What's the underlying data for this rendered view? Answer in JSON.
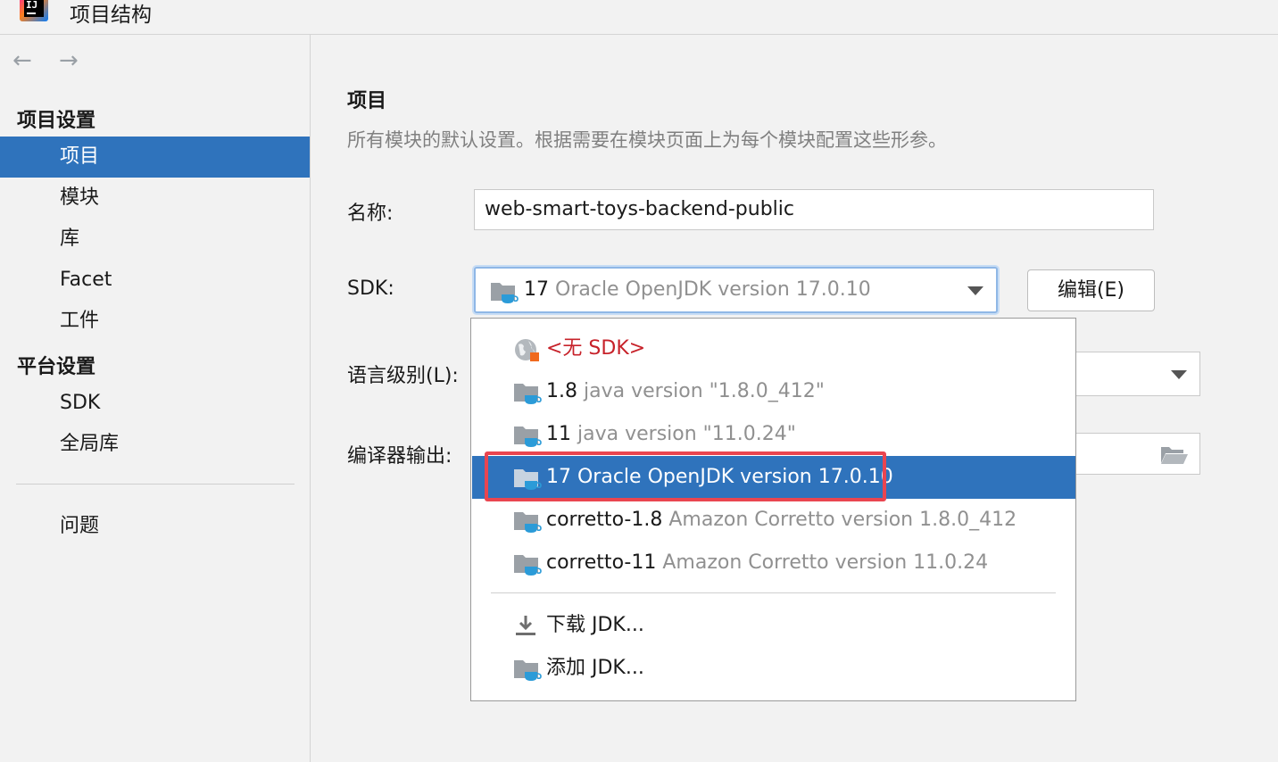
{
  "window": {
    "title": "项目结构"
  },
  "nav": {
    "back": "←",
    "forward": "→"
  },
  "sidebar": {
    "project_settings_header": "项目设置",
    "project_items": [
      "项目",
      "模块",
      "库",
      "Facet",
      "工件"
    ],
    "platform_settings_header": "平台设置",
    "platform_items": [
      "SDK",
      "全局库"
    ],
    "problems": "问题"
  },
  "main": {
    "title": "项目",
    "description": "所有模块的默认设置。根据需要在模块页面上为每个模块配置这些形参。",
    "name_label": "名称:",
    "name_value": "web-smart-toys-backend-public",
    "sdk_label": "SDK:",
    "sdk_selected_name": "17",
    "sdk_selected_desc": "Oracle OpenJDK version 17.0.10",
    "edit_button": "编辑(E)",
    "language_level_label": "语言级别(L):",
    "compiler_output_label": "编译器输出:"
  },
  "sdk_dropdown": {
    "no_sdk": "<无 SDK>",
    "options": [
      {
        "name": "1.8",
        "desc": "java version \"1.8.0_412\""
      },
      {
        "name": "11",
        "desc": "java version \"11.0.24\""
      },
      {
        "name": "17 Oracle OpenJDK version 17.0.10",
        "desc": ""
      },
      {
        "name": "corretto-1.8",
        "desc": "Amazon Corretto version 1.8.0_412"
      },
      {
        "name": "corretto-11",
        "desc": "Amazon Corretto version 11.0.24"
      }
    ],
    "download_jdk": "下载 JDK...",
    "add_jdk": "添加 JDK..."
  },
  "icons": {
    "app": "intellij-logo-icon",
    "folder": "jdk-folder-icon",
    "globe": "no-sdk-globe-icon",
    "download": "download-icon",
    "browse": "folder-open-icon"
  },
  "colors": {
    "selection": "#2f73bc",
    "highlight_box": "#e94550",
    "no_sdk_text": "#c7222a",
    "folder_blue": "#2b9bd8"
  }
}
